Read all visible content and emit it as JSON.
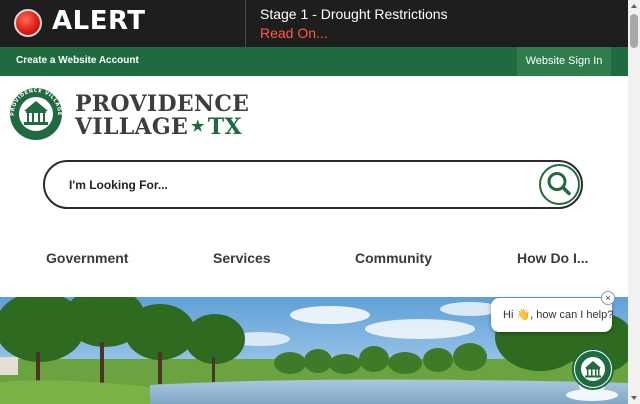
{
  "alert": {
    "label": "ALERT",
    "message": "Stage 1 - Drought Restrictions",
    "link": "Read On..."
  },
  "header": {
    "create_account": "Create a Website Account",
    "sign_in": "Website Sign In"
  },
  "logo": {
    "line1": "PROVIDENCE",
    "line2": "VILLAGE",
    "star": "★",
    "state": "TX",
    "seal_text": "PROVIDENCE VILLAGE"
  },
  "search": {
    "placeholder": "I'm Looking For..."
  },
  "nav": {
    "items": [
      {
        "label": "Government"
      },
      {
        "label": "Services"
      },
      {
        "label": "Community"
      },
      {
        "label": "How Do I..."
      }
    ]
  },
  "chat": {
    "greeting": "Hi 👋, how can I help?",
    "close": "×"
  },
  "colors": {
    "brand_green": "#1f6b3f",
    "alert_bar": "#1e1e1e",
    "alert_link": "#ff5a46"
  }
}
